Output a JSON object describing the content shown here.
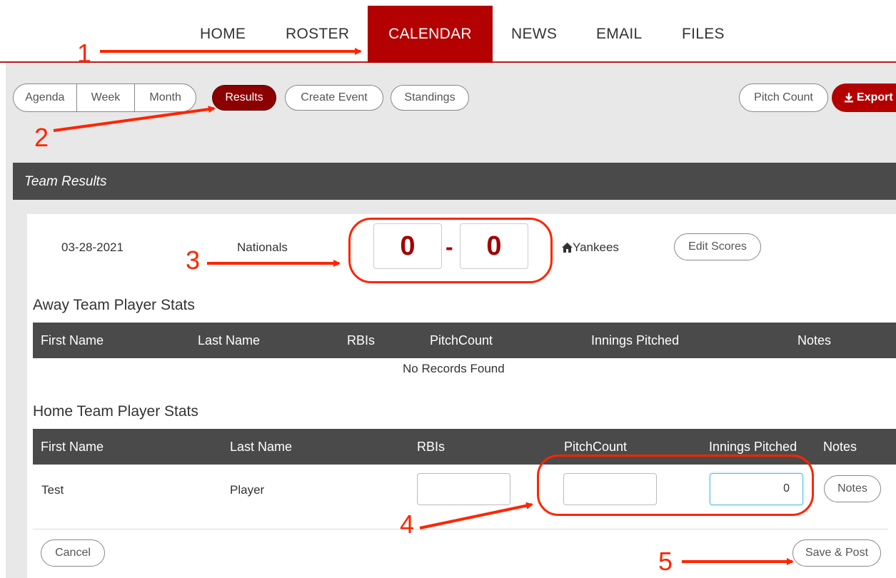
{
  "nav": {
    "items": [
      "HOME",
      "ROSTER",
      "CALENDAR",
      "NEWS",
      "EMAIL",
      "FILES"
    ],
    "active": "CALENDAR"
  },
  "toolbar": {
    "views": [
      "Agenda",
      "Week",
      "Month"
    ],
    "results_label": "Results",
    "create_event_label": "Create Event",
    "standings_label": "Standings",
    "pitch_count_label": "Pitch Count",
    "export_label": "Export",
    "export_icon": "download-icon"
  },
  "results_header": "Team Results",
  "game": {
    "date": "03-28-2021",
    "away_team": "Nationals",
    "away_score": "0",
    "separator": "-",
    "home_team": "Yankees",
    "home_icon": "home-icon",
    "edit_scores_label": "Edit Scores"
  },
  "away_stats": {
    "title": "Away Team Player Stats",
    "columns": [
      "First Name",
      "Last Name",
      "RBIs",
      "PitchCount",
      "Innings Pitched",
      "Notes"
    ],
    "empty_text": "No Records Found"
  },
  "home_stats": {
    "title": "Home Team Player Stats",
    "columns": [
      "First Name",
      "Last Name",
      "RBIs",
      "PitchCount",
      "Innings Pitched",
      "Notes"
    ],
    "rows": [
      {
        "first": "Test",
        "last": "Player",
        "rbis": "",
        "pitch_count": "",
        "innings_pitched": "0",
        "notes_label": "Notes"
      }
    ]
  },
  "footer": {
    "cancel_label": "Cancel",
    "save_label": "Save & Post"
  },
  "annotations": {
    "labels": [
      "1",
      "2",
      "3",
      "4",
      "5"
    ],
    "color": "#ff2400"
  },
  "colors": {
    "brand_red": "#b30000",
    "dark_red": "#8b0000",
    "header_gray": "#4a4a4a"
  }
}
